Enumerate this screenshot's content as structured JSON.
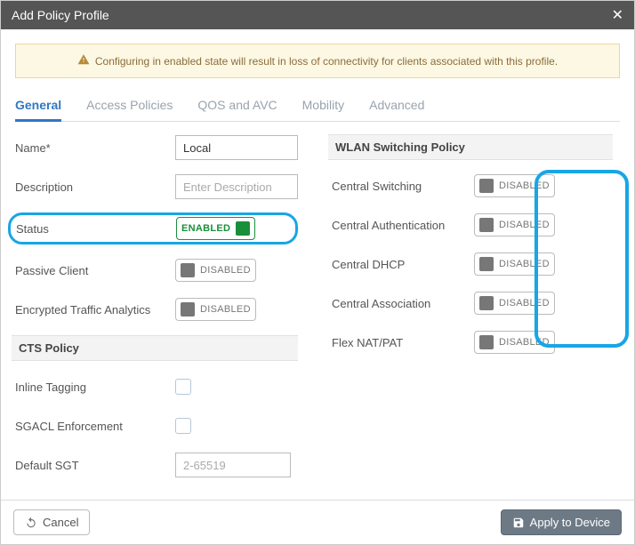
{
  "title": "Add Policy Profile",
  "warning": "Configuring in enabled state will result in loss of connectivity for clients associated with this profile.",
  "tabs": {
    "general": "General",
    "access": "Access Policies",
    "qos": "QOS and AVC",
    "mobility": "Mobility",
    "advanced": "Advanced"
  },
  "fields": {
    "name_label": "Name*",
    "name_value": "Local",
    "description_label": "Description",
    "description_placeholder": "Enter Description",
    "status_label": "Status",
    "passive_client_label": "Passive Client",
    "encrypted_label": "Encrypted Traffic Analytics",
    "cts_policy_header": "CTS Policy",
    "inline_tagging_label": "Inline Tagging",
    "sgacl_label": "SGACL Enforcement",
    "default_sgt_label": "Default SGT",
    "default_sgt_placeholder": "2-65519"
  },
  "toggles": {
    "enabled": "ENABLED",
    "disabled": "DISABLED"
  },
  "wlan": {
    "header": "WLAN Switching Policy",
    "central_switching": "Central Switching",
    "central_auth": "Central Authentication",
    "central_dhcp": "Central DHCP",
    "central_assoc": "Central Association",
    "flex_nat": "Flex NAT/PAT"
  },
  "buttons": {
    "cancel": "Cancel",
    "apply": "Apply to Device"
  }
}
